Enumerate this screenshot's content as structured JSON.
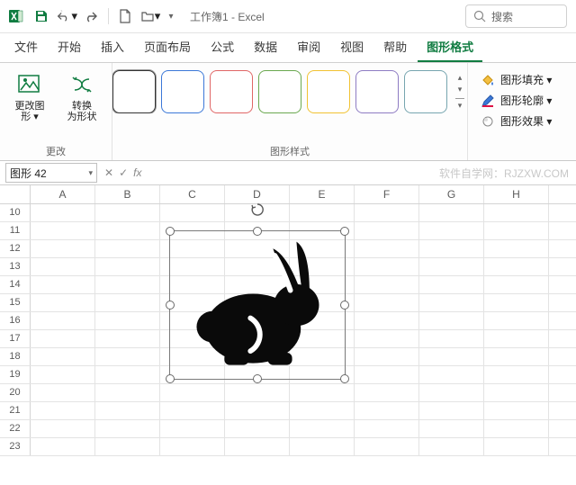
{
  "title": {
    "document": "工作簿1",
    "app": "Excel"
  },
  "qat": {
    "save": "保存",
    "undo": "撤销",
    "redo": "重做",
    "new": "新建",
    "open": "打开"
  },
  "search": {
    "placeholder": "搜索"
  },
  "tabs": {
    "file": "文件",
    "home": "开始",
    "insert": "插入",
    "layout": "页面布局",
    "formulas": "公式",
    "data": "数据",
    "review": "审阅",
    "view": "视图",
    "help": "帮助",
    "shapeformat": "图形格式"
  },
  "ribbon": {
    "change": {
      "group_label": "更改",
      "change_shape": "更改图\n形 ▾",
      "convert_to_shape": "转换\n为形状"
    },
    "styles": {
      "group_label": "图形样式",
      "preset_colors": [
        "#333333",
        "#3b78d8",
        "#e06666",
        "#6aa84f",
        "#f1c232",
        "#8e7cc3",
        "#76a5af"
      ]
    },
    "format": {
      "fill": "图形填充 ▾",
      "outline": "图形轮廓 ▾",
      "effects": "图形效果 ▾"
    }
  },
  "namebox": {
    "value": "图形 42"
  },
  "fxbar": {
    "fx_label": "fx"
  },
  "watermark": "软件自学网：RJZXW.COM",
  "grid": {
    "cols": [
      "A",
      "B",
      "C",
      "D",
      "E",
      "F",
      "G",
      "H"
    ],
    "rows": [
      10,
      11,
      12,
      13,
      14,
      15,
      16,
      17,
      18,
      19,
      20,
      21,
      22,
      23
    ]
  },
  "shape": {
    "name": "图形 42",
    "kind": "rabbit-icon"
  }
}
